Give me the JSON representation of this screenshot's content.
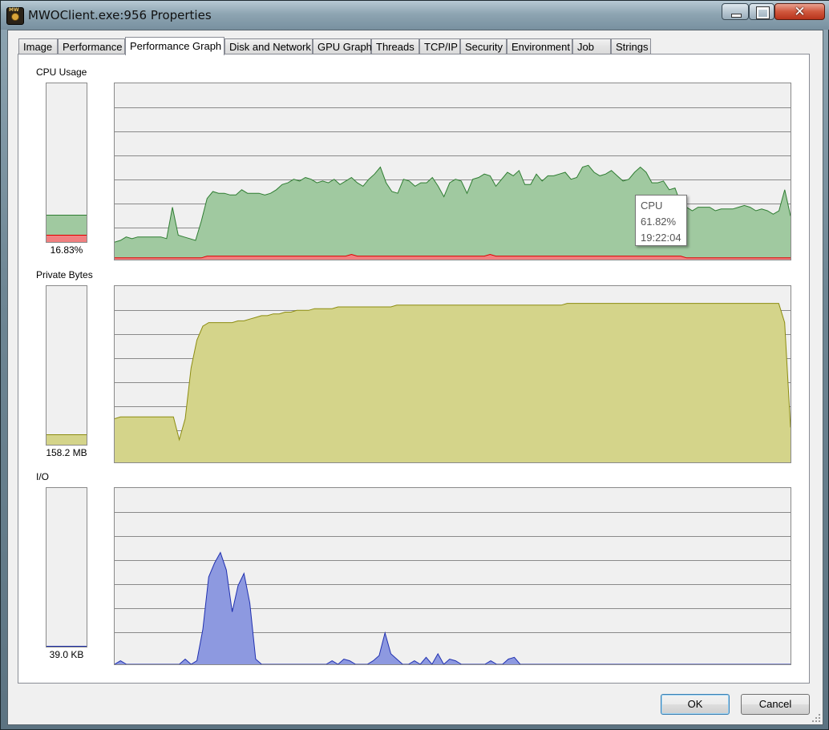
{
  "window": {
    "title": "MWOClient.exe:956 Properties",
    "close_glyph": "✕"
  },
  "tabs": [
    {
      "label": "Image",
      "active": false
    },
    {
      "label": "Performance",
      "active": false
    },
    {
      "label": "Performance Graph",
      "active": true
    },
    {
      "label": "Disk and Network",
      "active": false
    },
    {
      "label": "GPU Graph",
      "active": false
    },
    {
      "label": "Threads",
      "active": false
    },
    {
      "label": "TCP/IP",
      "active": false
    },
    {
      "label": "Security",
      "active": false
    },
    {
      "label": "Environment",
      "active": false
    },
    {
      "label": "Job",
      "active": false
    },
    {
      "label": "Strings",
      "active": false
    }
  ],
  "sections": {
    "cpu": {
      "label": "CPU Usage",
      "value": "16.83%",
      "meter_level_pct": 16.83,
      "meter_kernel_pct": 4
    },
    "private": {
      "label": "Private Bytes",
      "value": "158.2 MB",
      "meter_level_pct": 6
    },
    "io": {
      "label": "I/O",
      "value": "39.0  KB",
      "meter_level_pct": 0
    }
  },
  "tooltip": {
    "line1": "CPU",
    "line2": "61.82%",
    "line3": "19:22:04"
  },
  "buttons": {
    "ok": "OK",
    "cancel": "Cancel"
  },
  "colors": {
    "cpu_fill": "#a0c9a0",
    "cpu_line": "#2f7d32",
    "kernel_fill": "#f08080",
    "kernel_line": "#e00000",
    "private_fill": "#d4d48a",
    "private_line": "#8c8c10",
    "io_fill": "#8d99e0",
    "io_line": "#2030b0",
    "grid": "#8a8a8a",
    "graph_bg": "#f0f0f0"
  },
  "chart_data": [
    {
      "type": "area",
      "series": [
        {
          "values": [
            10,
            11,
            13,
            12,
            13,
            13,
            13,
            13,
            13,
            12,
            30,
            14,
            13,
            12,
            11,
            22,
            35,
            39,
            38,
            38,
            37,
            37,
            40,
            38,
            38,
            38,
            37,
            38,
            40,
            43,
            44,
            46,
            45,
            47,
            46,
            44,
            45,
            44,
            46,
            43,
            45,
            47,
            44,
            42,
            46,
            49,
            53,
            44,
            39,
            38,
            46,
            45,
            42,
            44,
            44,
            47,
            42,
            36,
            44,
            46,
            45,
            38,
            46,
            47,
            49,
            48,
            42,
            46,
            50,
            48,
            51,
            43,
            43,
            49,
            45,
            48,
            48,
            49,
            50,
            46,
            47,
            53,
            54,
            50,
            48,
            49,
            51,
            48,
            45,
            46,
            50,
            53,
            50,
            44,
            44,
            45,
            40,
            41,
            32,
            30,
            28,
            30,
            30,
            30,
            28,
            29,
            29,
            29,
            30,
            31,
            30,
            28,
            29,
            28,
            26,
            28,
            40,
            25
          ]
        },
        {
          "values": [
            1,
            1,
            1,
            1,
            1,
            1,
            1,
            1,
            1,
            1,
            1,
            1,
            1,
            1,
            1,
            1,
            2,
            2,
            2,
            2,
            2,
            2,
            2,
            2,
            2,
            2,
            2,
            2,
            2,
            2,
            2,
            2,
            2,
            2,
            2,
            2,
            2,
            2,
            2,
            2,
            2,
            3,
            2,
            2,
            2,
            2,
            2,
            2,
            2,
            2,
            2,
            2,
            2,
            2,
            2,
            2,
            2,
            2,
            2,
            2,
            2,
            2,
            2,
            2,
            2,
            3,
            2,
            2,
            2,
            2,
            2,
            2,
            2,
            2,
            2,
            2,
            2,
            2,
            2,
            2,
            2,
            2,
            2,
            2,
            2,
            2,
            2,
            2,
            2,
            2,
            2,
            2,
            2,
            2,
            2,
            2,
            2,
            2,
            2,
            1,
            1,
            1,
            1,
            1,
            1,
            1,
            1,
            1,
            1,
            1,
            1,
            1,
            1,
            1,
            1,
            1,
            1,
            1
          ]
        }
      ],
      "ylim": [
        0,
        100
      ]
    },
    {
      "type": "area",
      "series": [
        {
          "values": [
            25,
            26,
            26,
            26,
            26,
            26,
            26,
            26,
            26,
            26,
            26,
            13,
            25,
            54,
            70,
            78,
            80,
            80,
            80,
            80,
            80,
            81,
            81,
            82,
            83,
            84,
            84,
            85,
            85,
            86,
            86,
            87,
            87,
            87,
            88,
            88,
            88,
            88,
            89,
            89,
            89,
            89,
            89,
            89,
            89,
            89,
            89,
            89,
            90,
            90,
            90,
            90,
            90,
            90,
            90,
            90,
            90,
            90,
            90,
            90,
            90,
            90,
            90,
            90,
            90,
            90,
            90,
            90,
            90,
            90,
            90,
            90,
            90,
            90,
            90,
            90,
            90,
            91,
            91,
            91,
            91,
            91,
            91,
            91,
            91,
            91,
            91,
            91,
            91,
            91,
            91,
            91,
            91,
            91,
            91,
            91,
            91,
            91,
            91,
            91,
            91,
            91,
            91,
            91,
            91,
            91,
            91,
            91,
            91,
            91,
            91,
            91,
            91,
            91,
            80,
            20
          ]
        }
      ],
      "ylim": [
        0,
        100
      ]
    },
    {
      "type": "area",
      "series": [
        {
          "values": [
            0,
            2,
            0,
            0,
            0,
            0,
            0,
            0,
            0,
            0,
            0,
            0,
            3,
            0,
            2,
            20,
            50,
            58,
            64,
            54,
            30,
            45,
            52,
            35,
            3,
            0,
            0,
            0,
            0,
            0,
            0,
            0,
            0,
            0,
            0,
            0,
            0,
            2,
            0,
            3,
            2,
            0,
            0,
            0,
            2,
            5,
            18,
            6,
            3,
            0,
            0,
            2,
            0,
            4,
            0,
            6,
            0,
            3,
            2,
            0,
            0,
            0,
            0,
            0,
            2,
            0,
            0,
            3,
            4,
            0,
            0,
            0,
            0,
            0,
            0,
            0,
            0,
            0,
            0,
            0,
            0,
            0,
            0,
            0,
            0,
            0,
            0,
            0,
            0,
            0,
            0,
            0,
            0,
            0,
            0,
            0,
            0,
            0,
            0,
            0,
            0,
            0,
            0,
            0,
            0,
            0,
            0,
            0,
            0,
            0,
            0,
            0,
            0,
            0,
            0,
            0
          ]
        }
      ],
      "ylim": [
        0,
        100
      ]
    }
  ]
}
